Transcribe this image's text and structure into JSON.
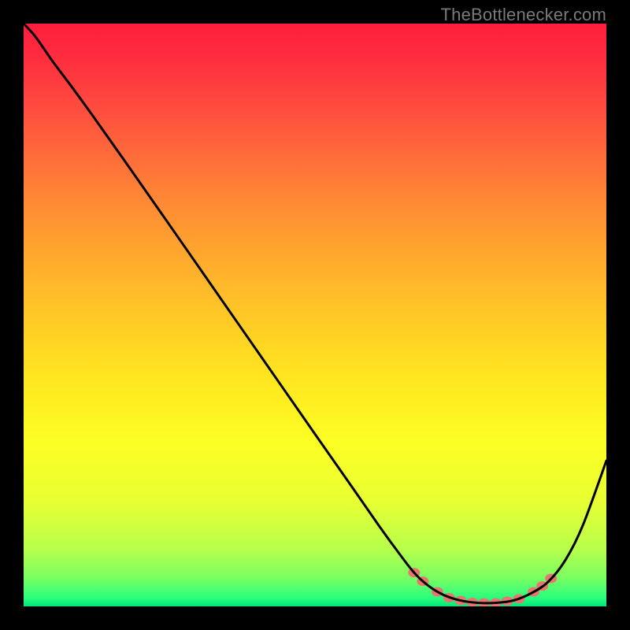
{
  "watermark": "TheBottlenecker.com",
  "chart_data": {
    "type": "line",
    "title": "",
    "xlabel": "",
    "ylabel": "",
    "xlim": [
      0,
      100
    ],
    "ylim": [
      0,
      100
    ],
    "background_gradient_stops": [
      {
        "offset": 0.0,
        "color": "#ff1f3d"
      },
      {
        "offset": 0.05,
        "color": "#ff2a3f"
      },
      {
        "offset": 0.15,
        "color": "#ff4e3f"
      },
      {
        "offset": 0.3,
        "color": "#ff8735"
      },
      {
        "offset": 0.45,
        "color": "#ffb92a"
      },
      {
        "offset": 0.6,
        "color": "#ffe41f"
      },
      {
        "offset": 0.72,
        "color": "#fcff24"
      },
      {
        "offset": 0.82,
        "color": "#e8ff33"
      },
      {
        "offset": 0.9,
        "color": "#b8ff4a"
      },
      {
        "offset": 0.95,
        "color": "#7cff62"
      },
      {
        "offset": 0.985,
        "color": "#2bff7e"
      },
      {
        "offset": 1.0,
        "color": "#00e676"
      }
    ],
    "series": [
      {
        "name": "bottleneck-curve",
        "stroke": "#000000",
        "stroke_width": 3,
        "points": [
          {
            "x": 0.0,
            "y": 100.0
          },
          {
            "x": 2.0,
            "y": 97.8
          },
          {
            "x": 5.0,
            "y": 93.5
          },
          {
            "x": 8.0,
            "y": 89.5
          },
          {
            "x": 12.0,
            "y": 84.0
          },
          {
            "x": 18.0,
            "y": 75.5
          },
          {
            "x": 25.0,
            "y": 65.5
          },
          {
            "x": 33.0,
            "y": 54.0
          },
          {
            "x": 41.0,
            "y": 42.5
          },
          {
            "x": 49.0,
            "y": 31.0
          },
          {
            "x": 56.0,
            "y": 21.0
          },
          {
            "x": 61.0,
            "y": 13.8
          },
          {
            "x": 64.5,
            "y": 9.0
          },
          {
            "x": 67.0,
            "y": 5.8
          },
          {
            "x": 69.5,
            "y": 3.5
          },
          {
            "x": 72.0,
            "y": 2.0
          },
          {
            "x": 75.0,
            "y": 1.0
          },
          {
            "x": 78.0,
            "y": 0.6
          },
          {
            "x": 81.0,
            "y": 0.6
          },
          {
            "x": 84.0,
            "y": 1.0
          },
          {
            "x": 87.0,
            "y": 2.2
          },
          {
            "x": 90.0,
            "y": 4.2
          },
          {
            "x": 93.0,
            "y": 8.0
          },
          {
            "x": 96.0,
            "y": 14.0
          },
          {
            "x": 100.0,
            "y": 25.0
          }
        ]
      },
      {
        "name": "highlight-dots",
        "fill": "#e8766f",
        "radius": 6,
        "points": [
          {
            "x": 67.0,
            "y": 5.8
          },
          {
            "x": 68.5,
            "y": 4.3
          },
          {
            "x": 71.0,
            "y": 2.5
          },
          {
            "x": 73.0,
            "y": 1.5
          },
          {
            "x": 75.0,
            "y": 1.0
          },
          {
            "x": 77.0,
            "y": 0.7
          },
          {
            "x": 79.0,
            "y": 0.6
          },
          {
            "x": 81.0,
            "y": 0.6
          },
          {
            "x": 83.0,
            "y": 0.9
          },
          {
            "x": 85.0,
            "y": 1.3
          },
          {
            "x": 87.5,
            "y": 2.5
          },
          {
            "x": 89.0,
            "y": 3.5
          },
          {
            "x": 90.5,
            "y": 4.8
          }
        ]
      }
    ]
  }
}
